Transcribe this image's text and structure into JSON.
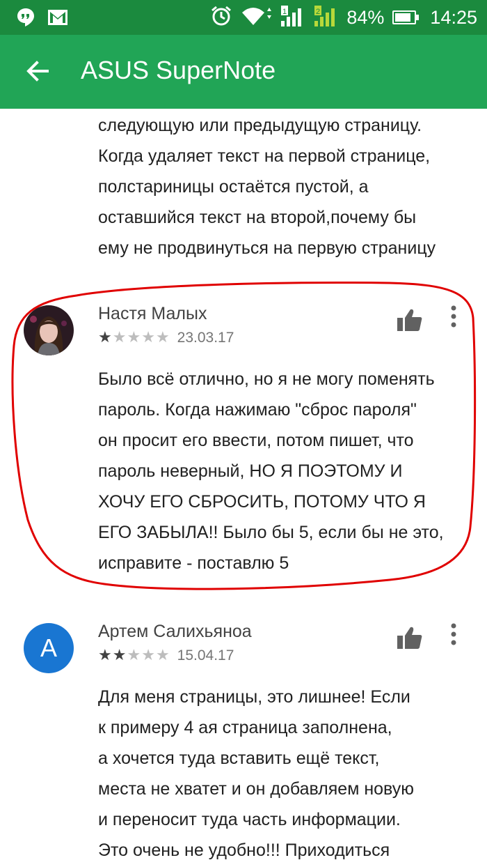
{
  "status_bar": {
    "battery": "84%",
    "time": "14:25",
    "battery_level": 0.84
  },
  "app_bar": {
    "title": "ASUS SuperNote"
  },
  "previous_review": {
    "lines": [
      "следующую или предыдущую страницу.",
      "Когда удаляет текст на первой странице,",
      "полстариницы остаётся пустой, а",
      "оставшийся текст на второй,почему бы",
      "ему не продвинуться на первую страницу"
    ]
  },
  "reviews": [
    {
      "author": "Настя Малых",
      "rating": 1,
      "date": "23.03.17",
      "lines": [
        "Было всё отлично, но я не могу поменять",
        "пароль. Когда нажимаю \"сброс пароля\"",
        "он просит его ввести, потом пишет, что",
        "пароль неверный, НО Я ПОЭТОМУ И",
        "ХОЧУ ЕГО СБРОСИТЬ, ПОТОМУ ЧТО Я",
        "ЕГО ЗАБЫЛА!! Было бы 5, если бы не это,",
        "исправите - поставлю 5"
      ]
    },
    {
      "author": "Артем Салихьяноа",
      "avatar_letter": "А",
      "rating": 2,
      "date": "15.04.17",
      "lines": [
        "Для меня страницы, это лишнее! Если",
        "к примеру 4 ая страница заполнена,",
        "а хочется туда вставить ещё текст,",
        "места не хватет и он добавляем новую",
        "и переносит туда часть информации.",
        "Это очень не удобно!!! Приходиться"
      ]
    }
  ],
  "colors": {
    "status_bar": "#1b8a3e",
    "app_bar": "#21a556",
    "annotation_red": "#e00000",
    "avatar_blue": "#1976d2"
  },
  "icons": {
    "back": "arrow-left-icon",
    "helpful": "thumbs-up-icon",
    "more": "more-vert-icon"
  }
}
